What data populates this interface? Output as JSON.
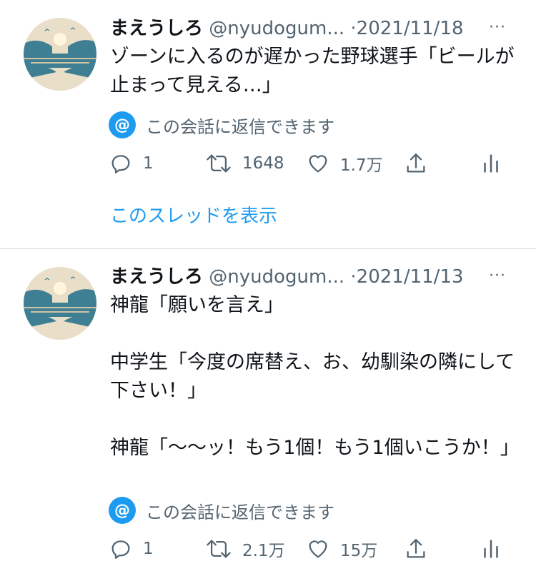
{
  "tweets": [
    {
      "name": "まえうしろ",
      "handle": "@nyudogum...",
      "separator": "·",
      "date": "2021/11/18",
      "more": "···",
      "text": "ゾーンに入るのが遅かった野球選手「ビールが止まって見える…」",
      "reply_notice": {
        "icon": "@",
        "label": "この会話に返信できます"
      },
      "actions": {
        "reply_count": "1",
        "retweet_count": "1648",
        "like_count": "1.7万"
      },
      "show_thread": "このスレッドを表示"
    },
    {
      "name": "まえうしろ",
      "handle": "@nyudogum...",
      "separator": "·",
      "date": "2021/11/13",
      "more": "···",
      "text": "神龍「願いを言え」\n\n中学生「今度の席替え、お、幼馴染の隣にして下さい！」\n\n神龍「〜〜ッ！もう1個！もう1個いこうか！」",
      "reply_notice": {
        "icon": "@",
        "label": "この会話に返信できます"
      },
      "actions": {
        "reply_count": "1",
        "retweet_count": "2.1万",
        "like_count": "15万"
      }
    }
  ],
  "colors": {
    "accent": "#1d9bf0",
    "text": "#0f1419",
    "secondary": "#536471",
    "divider": "#d8dde1"
  },
  "icons": [
    "avatar",
    "more-icon",
    "at-icon",
    "reply-icon",
    "retweet-icon",
    "like-icon",
    "share-icon",
    "analytics-icon"
  ]
}
